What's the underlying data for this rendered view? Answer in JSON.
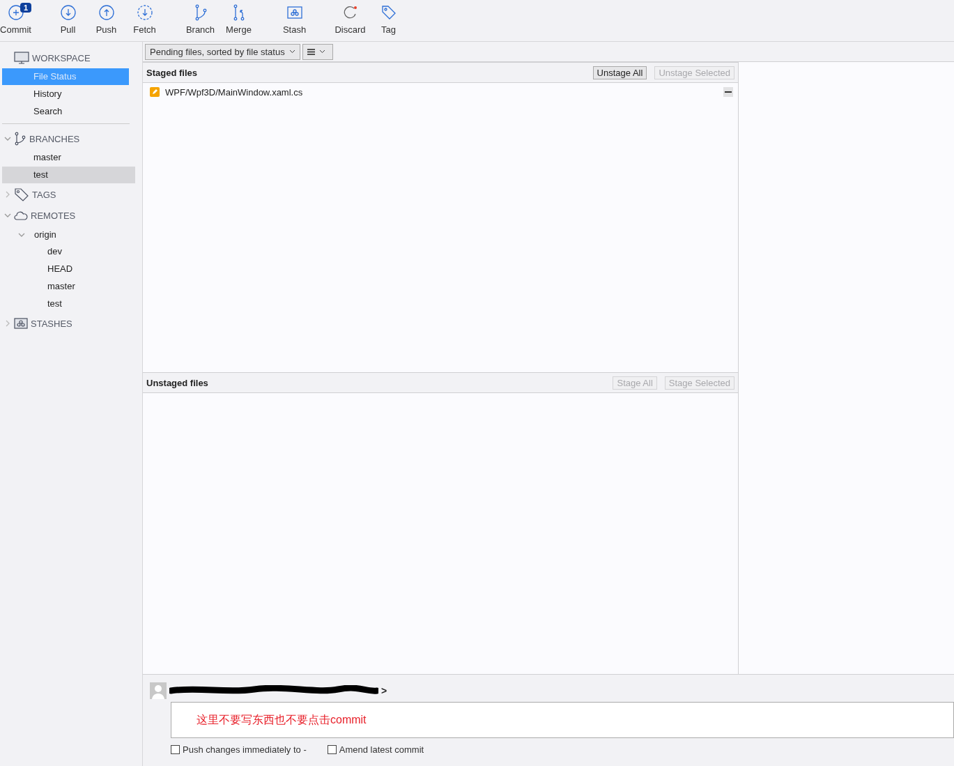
{
  "toolbar": {
    "groups": [
      [
        {
          "kind": "commit",
          "label": "Commit",
          "badge": "1"
        }
      ],
      [
        {
          "kind": "pull",
          "label": "Pull"
        },
        {
          "kind": "push",
          "label": "Push"
        },
        {
          "kind": "fetch",
          "label": "Fetch"
        }
      ],
      [
        {
          "kind": "branch",
          "label": "Branch"
        },
        {
          "kind": "merge",
          "label": "Merge"
        }
      ],
      [
        {
          "kind": "stash",
          "label": "Stash"
        }
      ],
      [
        {
          "kind": "discard",
          "label": "Discard"
        },
        {
          "kind": "tag",
          "label": "Tag"
        }
      ]
    ]
  },
  "sidebar": {
    "sections": [
      {
        "kind": "workspace",
        "title": "WORKSPACE",
        "items": [
          {
            "label": "File Status",
            "selected": true
          },
          {
            "label": "History",
            "selected": false
          },
          {
            "label": "Search",
            "selected": false
          }
        ]
      },
      {
        "kind": "branches",
        "title": "BRANCHES",
        "expanded": true,
        "items": [
          {
            "label": "master",
            "current": false
          },
          {
            "label": "test",
            "current": true
          }
        ]
      },
      {
        "kind": "tags",
        "title": "TAGS",
        "expanded": false
      },
      {
        "kind": "remotes",
        "title": "REMOTES",
        "expanded": true,
        "items": [
          {
            "label": "origin",
            "expanded": true,
            "children": [
              {
                "label": "dev"
              },
              {
                "label": "HEAD"
              },
              {
                "label": "master"
              },
              {
                "label": "test"
              }
            ]
          }
        ]
      },
      {
        "kind": "stashes",
        "title": "STASHES",
        "expanded": false
      }
    ]
  },
  "filter": {
    "dropdown": "Pending files, sorted by file status"
  },
  "panels": [
    {
      "title": "Staged files",
      "buttons": [
        {
          "label": "Unstage All",
          "disabled": false
        },
        {
          "label": "Unstage Selected",
          "disabled": true
        }
      ],
      "files": [
        {
          "path": "WPF/Wpf3D/MainWindow.xaml.cs",
          "kind": "modified"
        }
      ]
    },
    {
      "title": "Unstaged files",
      "buttons": [
        {
          "label": "Stage All",
          "disabled": true
        },
        {
          "label": "Stage Selected",
          "disabled": true
        }
      ]
    }
  ],
  "commit": {
    "author_suffix": ">",
    "message": "这里不要写东西也不要点击commit",
    "options": [
      {
        "label": "Push changes immediately to -",
        "checked": false
      },
      {
        "label": "Amend latest commit",
        "checked": false
      }
    ]
  }
}
